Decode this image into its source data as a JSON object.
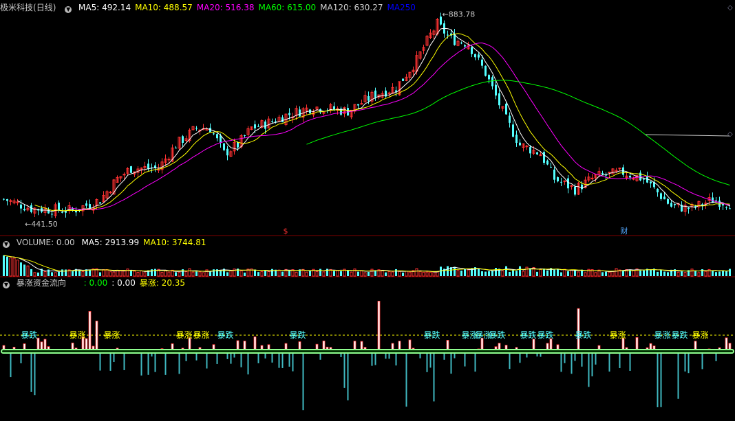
{
  "colors": {
    "up": "#ff3232",
    "down": "#54ffff",
    "ma5": "#ffffff",
    "ma10": "#ffff00",
    "ma20": "#ff00ff",
    "ma60": "#00ff00",
    "ma120": "#d0d0d0",
    "ma250": "#0000ff",
    "bg": "#000000",
    "separator": "#800000"
  },
  "price_panel": {
    "stock_name": "极米科技",
    "period": "(日线)",
    "ma_labels": [
      {
        "text": "MA5: 492.14",
        "color": "#ffffff"
      },
      {
        "text": "MA10: 488.57",
        "color": "#ffff00"
      },
      {
        "text": "MA20: 516.38",
        "color": "#ff00ff"
      },
      {
        "text": "MA60: 615.00",
        "color": "#00ff00"
      },
      {
        "text": "MA120: 630.27",
        "color": "#d0d0d0"
      },
      {
        "text": "MA250",
        "color": "#0000ff"
      }
    ],
    "high_annotation": "883.78",
    "low_annotation": "441.50",
    "event_markers": [
      {
        "text": "$",
        "color": "#ff3232",
        "candle": 82
      },
      {
        "text": "财",
        "color": "#54a8ff",
        "candle": 180
      }
    ]
  },
  "volume_panel": {
    "title": "VOLUME: 0.00",
    "labels": [
      {
        "text": "MA5: 2913.99",
        "color": "#ffffff"
      },
      {
        "text": "MA10: 3744.81",
        "color": "#ffff00"
      }
    ]
  },
  "indicator_panel": {
    "title": "暴涨资金流向",
    "labels": [
      {
        "text": ": 0.00",
        "color": "#00ff00"
      },
      {
        "text": ": 0.00",
        "color": "#ffffff"
      },
      {
        "text": "暴涨: 20.35",
        "color": "#ffff00"
      }
    ],
    "tags": [
      {
        "text": "暴跌",
        "color": "#54ffff",
        "candle": 7
      },
      {
        "text": "暴涨",
        "color": "#ffff00",
        "candle": 21
      },
      {
        "text": "暴涨",
        "color": "#ffff00",
        "candle": 31
      },
      {
        "text": "暴涨",
        "color": "#ffff00",
        "candle": 52
      },
      {
        "text": "暴涨",
        "color": "#ffff00",
        "candle": 57
      },
      {
        "text": "暴跌",
        "color": "#54ffff",
        "candle": 64
      },
      {
        "text": "暴跌",
        "color": "#54ffff",
        "candle": 85
      },
      {
        "text": "暴跌",
        "color": "#54ffff",
        "candle": 124
      },
      {
        "text": "暴涨",
        "color": "#54ffff",
        "candle": 135
      },
      {
        "text": "暴涨",
        "color": "#54ffff",
        "candle": 139
      },
      {
        "text": "暴跌",
        "color": "#54ffff",
        "candle": 143
      },
      {
        "text": "暴跌",
        "color": "#54ffff",
        "candle": 152
      },
      {
        "text": "暴跌",
        "color": "#54ffff",
        "candle": 157
      },
      {
        "text": "暴跌",
        "color": "#54ffff",
        "candle": 168
      },
      {
        "text": "暴涨",
        "color": "#ffff00",
        "candle": 178
      },
      {
        "text": "暴涨",
        "color": "#54ffff",
        "candle": 191
      },
      {
        "text": "暴跌",
        "color": "#54ffff",
        "candle": 196
      },
      {
        "text": "暴涨",
        "color": "#ffff00",
        "candle": 202
      }
    ]
  },
  "chart_data": {
    "type": "candlestick",
    "candle_count": 212,
    "price_range": [
      420,
      920
    ],
    "note_values": {
      "high": 883.78,
      "low": 441.5
    }
  }
}
